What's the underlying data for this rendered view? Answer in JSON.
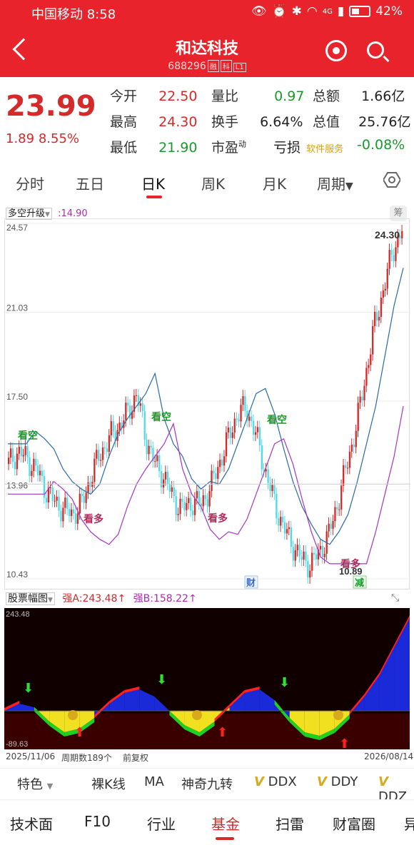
{
  "status_bar": {
    "carrier": "中国移动",
    "time": "8:58",
    "battery": "42%",
    "network": "4G"
  },
  "header": {
    "stock_name": "和达科技",
    "stock_code": "688296",
    "tag1": "融",
    "tag2": "科",
    "tag3": "L1"
  },
  "quote": {
    "price": "23.99",
    "change": "1.89",
    "change_pct": "8.55%",
    "open_label": "今开",
    "open": "22.50",
    "high_label": "最高",
    "high": "24.30",
    "low_label": "最低",
    "low": "21.90",
    "vol_ratio_label": "量比",
    "vol_ratio": "0.97",
    "turnover_label": "换手",
    "turnover": "6.64%",
    "pe_label": "市盈",
    "pe_sup": "动",
    "amount_label": "总额",
    "amount": "1.66亿",
    "mktcap_label": "总值",
    "mktcap": "25.76亿",
    "loss_label": "亏损",
    "sector": "软件服务",
    "sector_change": "-0.08%"
  },
  "tabs": [
    "分时",
    "五日",
    "日K",
    "周K",
    "月K",
    "周期"
  ],
  "chart": {
    "indicator_name": "多空升级",
    "indicator_value": ":14.90",
    "chip_label": "筹",
    "y_labels": [
      "24.57",
      "21.03",
      "17.50",
      "13.96",
      "10.43"
    ],
    "high_marker": "24.30",
    "low_marker": "10.89",
    "signal_bear": "看空",
    "signal_bull": "看多",
    "event_cai": "财",
    "event_jian": "减"
  },
  "sub_indicator": {
    "name": "股票幅图",
    "strong_a_label": "强A:",
    "strong_a": "243.48",
    "strong_b_label": "强B:",
    "strong_b": "158.22",
    "top": "243.48",
    "bottom": "-89.63"
  },
  "footer": {
    "start_date": "2025/11/06",
    "period_count": "周期数189个",
    "adjust": "前复权",
    "end_date": "2026/08/14"
  },
  "toolbar": [
    "特色",
    "裸K线",
    "MA",
    "神奇九转",
    "DDX",
    "DDY",
    "DDZ"
  ],
  "bottom_nav": [
    "技术面",
    "F10",
    "行业",
    "基金",
    "扫雷",
    "财富圈",
    "异"
  ],
  "colors": {
    "red": "#e8232b",
    "up": "#d42a2a",
    "down_cyan": "#4fdbe8",
    "green": "#1a9a2a",
    "purple": "#a833c8",
    "blue_line": "#2a6aa8"
  }
}
